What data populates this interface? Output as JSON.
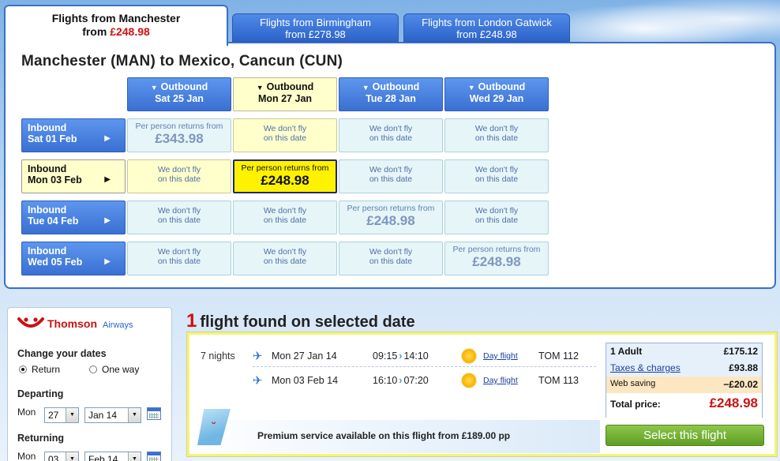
{
  "tabs": [
    {
      "line1": "Flights from Manchester",
      "line2_prefix": "from ",
      "price": "£248.98"
    },
    {
      "line1": "Flights from Birmingham",
      "line2": "from £278.98"
    },
    {
      "line1": "Flights from London Gatwick",
      "line2": "from £248.98"
    }
  ],
  "route_title": "Manchester (MAN) to Mexico, Cancun (CUN)",
  "outbound": [
    {
      "label": "Outbound",
      "date": "Sat 25 Jan"
    },
    {
      "label": "Outbound",
      "date": "Mon 27 Jan"
    },
    {
      "label": "Outbound",
      "date": "Tue 28 Jan"
    },
    {
      "label": "Outbound",
      "date": "Wed 29 Jan"
    }
  ],
  "inbound": [
    {
      "label": "Inbound",
      "date": "Sat 01 Feb"
    },
    {
      "label": "Inbound",
      "date": "Mon 03 Feb"
    },
    {
      "label": "Inbound",
      "date": "Tue 04 Feb"
    },
    {
      "label": "Inbound",
      "date": "Wed 05 Feb"
    }
  ],
  "grid": {
    "no_fly_1": "We don't fly",
    "no_fly_2": "on this date",
    "pp": "Per person returns from",
    "r0c0": "£343.98",
    "r1c1": "£248.98",
    "r2c2": "£248.98",
    "r3c3": "£248.98"
  },
  "sidebar": {
    "brand": "Thomson",
    "airways": "Airways",
    "change_dates": "Change your dates",
    "return_label": "Return",
    "oneway_label": "One way",
    "departing": "Departing",
    "returning": "Returning",
    "mon": "Mon",
    "dep_day": "27",
    "dep_month": "Jan 14",
    "ret_day": "03",
    "ret_month": "Feb 14"
  },
  "results": {
    "count": "1",
    "found_text": "flight found on selected date",
    "nights": "7 nights",
    "legs": [
      {
        "date": "Mon 27 Jan 14",
        "dep": "09:15",
        "arr": "14:10",
        "type": "Day flight",
        "flight_no": "TOM 112"
      },
      {
        "date": "Mon 03 Feb 14",
        "dep": "16:10",
        "arr": "07:20",
        "type": "Day flight",
        "flight_no": "TOM 113"
      }
    ],
    "promo": "Premium service available on this flight from £189.00 pp",
    "price": {
      "adult_label": "1 Adult",
      "adult_value": "£175.12",
      "tax_label": "Taxes & charges",
      "tax_value": "£93.88",
      "web_label": "Web saving",
      "web_value": "−£20.02",
      "total_label": "Total price:",
      "total_value": "£248.98"
    },
    "select_label": "Select this flight"
  },
  "colors": {
    "accent": "#3a70d3",
    "price_red": "#cc1111",
    "selected_yellow": "#fff200",
    "button_green": "#6aa92d"
  },
  "icons": {
    "tail": "thomson-tail-icon",
    "plane": "plane-icon",
    "sun": "sun-icon",
    "calendar": "calendar-icon"
  }
}
